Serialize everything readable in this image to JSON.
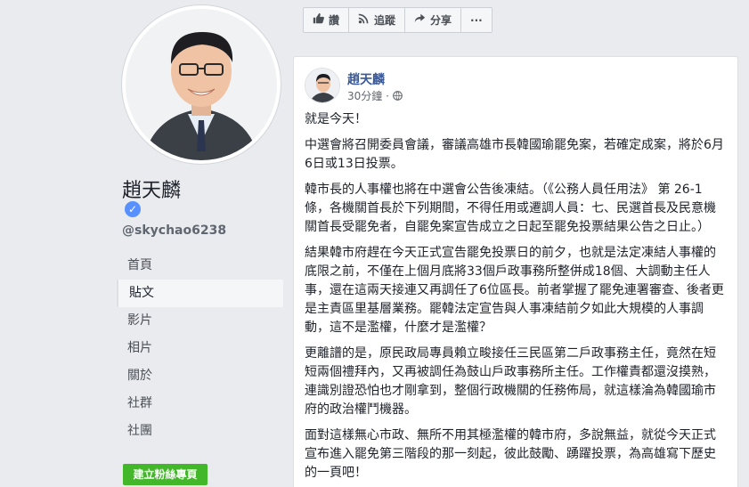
{
  "sidebar": {
    "page_name": "趙天麟",
    "verified_icon": "check",
    "handle": "@skychao6238",
    "nav": [
      "首頁",
      "貼文",
      "影片",
      "相片",
      "關於",
      "社群",
      "社團"
    ],
    "active_index": 1,
    "create_button": "建立粉絲專頁"
  },
  "actions": {
    "like_label": "讚",
    "follow_label": "追蹤",
    "share_label": "分享",
    "more_label": "···"
  },
  "post": {
    "author": "趙天麟",
    "time": "30分鐘 · ",
    "privacy_icon": "globe-icon",
    "paragraphs": [
      "就是今天！",
      "中選會將召開委員會議，審議高雄市長韓國瑜罷免案，若確定成案，將於6月6日或13日投票。",
      "韓市長的人事權也將在中選會公告後凍結。（《公務人員任用法》 第 26-1 條，各機關首長於下列期間，不得任用或遷調人員：七、民選首長及民意機關首長受罷免者，自罷免案宣告成立之日起至罷免投票結果公告之日止。）",
      "結果韓市府趕在今天正式宣告罷免投票日的前夕，也就是法定凍結人事權的底限之前，不僅在上個月底將33個戶政事務所整併成18個、大調動主任人事，還在這兩天接連又再調任了6位區長。前者掌握了罷免連署審查、後者更是主責區里基層業務。罷韓法定宣告與人事凍結前夕如此大規模的人事調動，這不是濫權，什麼才是濫權？",
      "更離譜的是，原民政局專員賴立畯接任三民區第二戶政事務主任，竟然在短短兩個禮拜內，又再被調任為鼓山戶政事務所主任。工作權責都還沒摸熟，連識別證恐怕也才剛拿到，整個行政機關的任務佈局，就這樣淪為韓國瑜市府的政治權鬥機器。",
      "面對這樣無心市政、無所不用其極濫權的韓市府，多說無益，就從今天正式宣布進入罷免第三階段的那一刻起，彼此鼓勵、踴躍投票，為高雄寫下歷史的一頁吧！"
    ]
  },
  "colors": {
    "background": "#e9ebee",
    "link": "#385898",
    "green": "#42b72a",
    "verified": "#5890ff"
  }
}
